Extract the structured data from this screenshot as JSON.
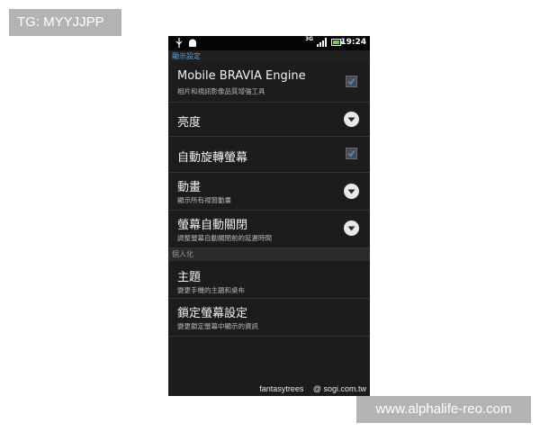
{
  "overlays": {
    "tag_label": "TG: MYYJJPP",
    "site_watermark": "www.alphalife-reo.com"
  },
  "statusbar": {
    "time": "19:24",
    "network": "3G",
    "icons": [
      "usb-icon",
      "android-icon",
      "signal-icon",
      "battery-icon"
    ]
  },
  "settings": {
    "display_section_header": "顯示設定",
    "items": [
      {
        "title": "Mobile BRAVIA Engine",
        "subtitle": "相片和視訊影像品質增強工具",
        "control": "checkbox",
        "checked": true
      },
      {
        "title": "亮度",
        "subtitle": "",
        "control": "dropdown"
      },
      {
        "title": "自動旋轉螢幕",
        "subtitle": "",
        "control": "checkbox",
        "checked": true
      },
      {
        "title": "動畫",
        "subtitle": "顯示所有視窗動畫",
        "control": "dropdown"
      },
      {
        "title": "螢幕自動關閉",
        "subtitle": "調整螢幕自動關閉前的延遲時間",
        "control": "dropdown"
      }
    ],
    "personal_section_header": "個人化",
    "personal_items": [
      {
        "title": "主題",
        "subtitle": "變更手機的主題和桌布"
      },
      {
        "title": "鎖定螢幕設定",
        "subtitle": "變更鎖定螢幕中顯示的資訊"
      }
    ]
  },
  "footer": {
    "author": "fantasytrees",
    "site": "@ sogi.com.tw"
  },
  "colors": {
    "background": "#1c1c1c",
    "accent_blue": "#5aa8d8",
    "check_blue": "#3d8fd6"
  }
}
